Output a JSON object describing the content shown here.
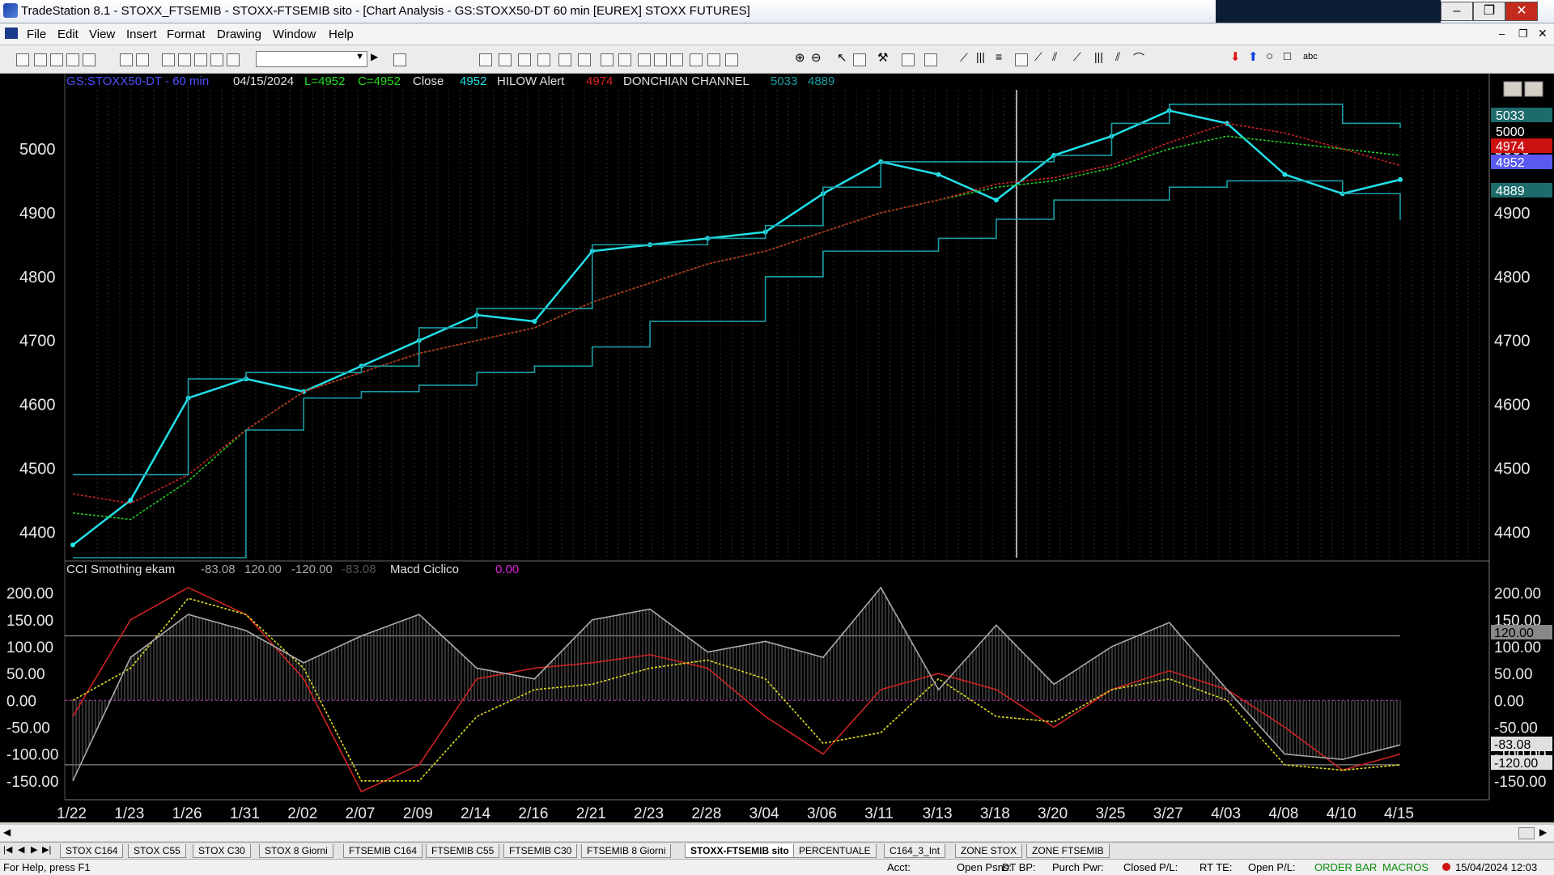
{
  "window": {
    "title": "TradeStation 8.1 - STOXX_FTSEMIB - STOXX-FTSEMIB sito - [Chart Analysis - GS:STOXX50-DT  60 min  [EUREX] STOXX FUTURES]"
  },
  "menu": [
    "File",
    "Edit",
    "View",
    "Insert",
    "Format",
    "Drawing",
    "Window",
    "Help"
  ],
  "chart_header": {
    "symbol": "GS:STOXX50-DT - 60 min",
    "date": "04/15/2024",
    "low": "L=4952",
    "close": "C=4952",
    "close_label": "Close",
    "close_value": "4952",
    "hilow": "HILOW Alert",
    "hilow_value": "4974",
    "donchian": "DONCHIAN CHANNEL",
    "donchian_upper": "5033",
    "donchian_lower": "4889"
  },
  "sub_header": {
    "indicator": "CCI Smothing ekam",
    "v1": "-83.08",
    "v2": "120.00",
    "v3": "-120.00",
    "v4": "-83.08",
    "macd": "Macd Ciclico",
    "macd_value": "0.00"
  },
  "price_badges": {
    "b1": "5033",
    "b2": "5000",
    "b3": "4974",
    "b4": "4952",
    "b5": "4889"
  },
  "cci_badges": {
    "b1": "120.00",
    "b2": "-83.08",
    "b3": "-120.00"
  },
  "chart_data": [
    {
      "type": "line",
      "title": "GS:STOXX50-DT - 60 min",
      "x": [
        "1/22",
        "1/23",
        "1/26",
        "1/31",
        "2/02",
        "2/07",
        "2/09",
        "2/14",
        "2/16",
        "2/21",
        "2/23",
        "2/28",
        "3/04",
        "3/06",
        "3/11",
        "3/13",
        "3/18",
        "3/20",
        "3/25",
        "3/27",
        "4/03",
        "4/08",
        "4/10",
        "4/15"
      ],
      "yticks": [
        4400,
        4500,
        4600,
        4700,
        4800,
        4900,
        5000
      ],
      "ylim": [
        4360,
        5090
      ],
      "series": [
        {
          "name": "Close",
          "color": "#22e0e8",
          "values": [
            4380,
            4450,
            4610,
            4640,
            4620,
            4660,
            4700,
            4740,
            4730,
            4840,
            4850,
            4860,
            4870,
            4930,
            4980,
            4960,
            4920,
            4990,
            5020,
            5060,
            5040,
            4960,
            4930,
            4952
          ]
        },
        {
          "color": "#22cc22",
          "values": [
            4430,
            4420,
            4480,
            4560,
            4620,
            4650,
            4680,
            4700,
            4720,
            4760,
            4790,
            4820,
            4840,
            4870,
            4900,
            4920,
            4940,
            4950,
            4970,
            5000,
            5020,
            5010,
            5000,
            4990
          ]
        },
        {
          "color": "#cc2222",
          "values": [
            4460,
            4445,
            4490,
            4560,
            4620,
            4650,
            4680,
            4700,
            4720,
            4760,
            4790,
            4820,
            4840,
            4870,
            4900,
            4920,
            4945,
            4955,
            4975,
            5010,
            5040,
            5025,
            5000,
            4974
          ]
        },
        {
          "name": "DONCHIAN CHANNEL",
          "color": "#1a9ea6",
          "values": [
            4490,
            4490,
            4640,
            4650,
            4650,
            4660,
            4720,
            4750,
            4750,
            4850,
            4850,
            4860,
            4880,
            4940,
            4980,
            4980,
            4980,
            4990,
            5040,
            5070,
            5070,
            5070,
            5040,
            5033
          ]
        },
        {
          "color": "#1a9ea6",
          "values": [
            4360,
            4360,
            4360,
            4560,
            4610,
            4620,
            4630,
            4650,
            4660,
            4690,
            4730,
            4730,
            4800,
            4840,
            4840,
            4860,
            4890,
            4920,
            4920,
            4940,
            4950,
            4950,
            4930,
            4889
          ]
        }
      ]
    },
    {
      "type": "line",
      "title": "CCI Smothing ekam",
      "yticks": [
        200,
        150,
        100,
        50,
        0,
        -50,
        -100,
        -150
      ],
      "ylim": [
        -185,
        225
      ],
      "series": [
        {
          "color": "#cc2222",
          "values": [
            -30,
            150,
            210,
            160,
            40,
            -170,
            -120,
            40,
            60,
            70,
            85,
            60,
            -30,
            -100,
            20,
            50,
            20,
            -50,
            20,
            55,
            20,
            -50,
            -130,
            -100
          ]
        },
        {
          "color": "#dddd22",
          "values": [
            0,
            60,
            190,
            160,
            60,
            -150,
            -150,
            -30,
            20,
            30,
            60,
            75,
            40,
            -80,
            -60,
            40,
            -30,
            -40,
            20,
            40,
            0,
            -120,
            -130,
            -120
          ]
        },
        {
          "color": "#aaaaaa",
          "values": [
            -150,
            80,
            160,
            130,
            70,
            120,
            160,
            60,
            40,
            150,
            170,
            90,
            110,
            80,
            210,
            20,
            140,
            30,
            100,
            145,
            20,
            -100,
            -110,
            -83
          ]
        }
      ]
    }
  ],
  "sheet_tabs": [
    "STOX C164",
    "STOX C55",
    "STOX  C30",
    "STOX  8 Giorni",
    "FTSEMIB C164",
    "FTSEMIB C55",
    "FTSEMIB C30",
    "FTSEMIB  8 Giorni",
    "STOXX-FTSEMIB sito",
    "PERCENTUALE",
    "C164_3_Int",
    "ZONE STOX",
    "ZONE FTSEMIB"
  ],
  "status": {
    "help": "For Help, press F1",
    "acct": "Acct:",
    "open_psns": "Open Psns:",
    "dt_bp": "DT BP:",
    "purch_pwr": "Purch Pwr:",
    "closed_pl": "Closed P/L:",
    "rt_te": "RT TE:",
    "open_pl": "Open P/L:",
    "order_bar": "ORDER BAR",
    "macros": "MACROS",
    "datetime": "15/04/2024 12:03"
  }
}
